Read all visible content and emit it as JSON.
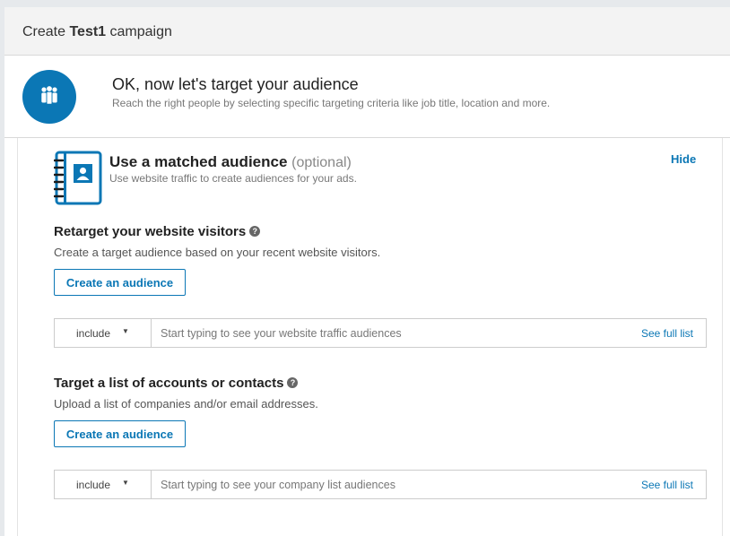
{
  "header": {
    "title_prefix": "Create ",
    "campaign_name": "Test1",
    "title_suffix": " campaign"
  },
  "intro": {
    "icon": "audience-group-icon",
    "title": "OK, now let's target your audience",
    "subtitle": "Reach the right people by selecting specific targeting criteria like job title, location and more."
  },
  "matched_audience": {
    "icon": "contact-book-icon",
    "title": "Use a matched audience",
    "optional": "(optional)",
    "subtitle": "Use website traffic to create audiences for your ads.",
    "hide_label": "Hide"
  },
  "retarget": {
    "title": "Retarget your website visitors",
    "help_icon": "question-circle-icon",
    "description": "Create a target audience based on your recent website visitors.",
    "button_label": "Create an audience",
    "include_value": "include",
    "placeholder": "Start typing to see your website traffic audiences",
    "see_full_list": "See full list"
  },
  "accounts": {
    "title": "Target a list of accounts or contacts",
    "help_icon": "question-circle-icon",
    "description": "Upload a list of companies and/or email addresses.",
    "button_label": "Create an audience",
    "include_value": "include",
    "placeholder": "Start typing to see your company list audiences",
    "see_full_list": "See full list"
  },
  "colors": {
    "accent": "#0b77b5",
    "background": "#e6e9ec"
  }
}
